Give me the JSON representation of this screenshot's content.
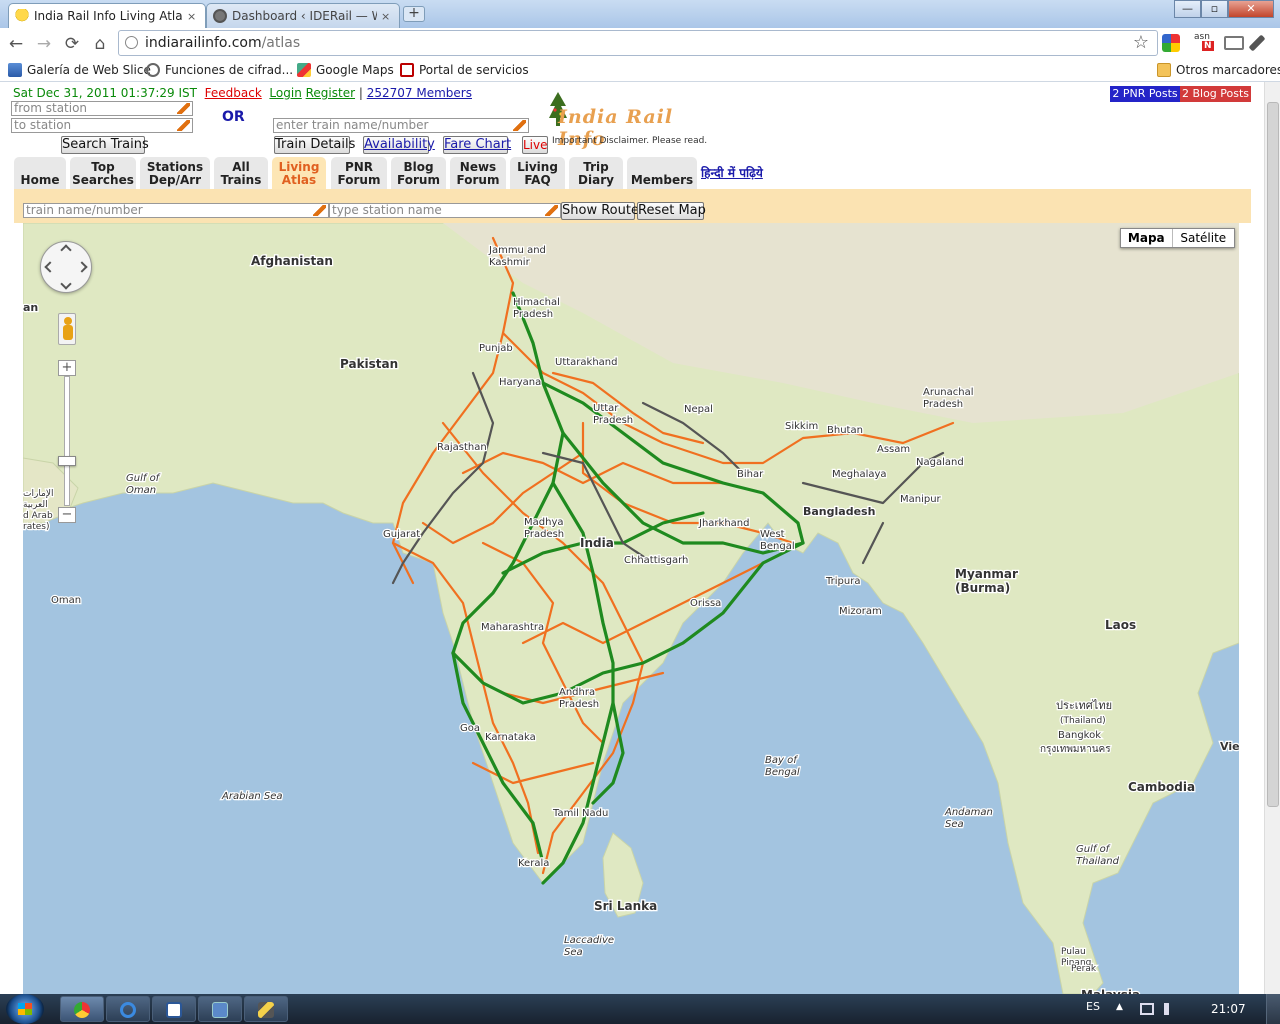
{
  "browser": {
    "tabs": [
      {
        "title": "India Rail Info Living Atlas -",
        "close": "×",
        "active": true
      },
      {
        "title": "Dashboard ‹ IDERail — Wor",
        "close": "×",
        "active": false
      }
    ],
    "new_tab": "+",
    "window_controls": {
      "minimize": "—",
      "maximize": "▫",
      "close": "✕"
    },
    "nav": {
      "back": "←",
      "forward": "→",
      "reload": "⟳",
      "home": "⌂"
    },
    "url_host": "indiarailinfo.com",
    "url_path": "/atlas",
    "star": "☆",
    "bookmarks": [
      {
        "label": "Galería de Web Slice",
        "icon": "web-slice-icon"
      },
      {
        "label": "Funciones de cifrad...",
        "icon": "globe-icon"
      },
      {
        "label": "Google Maps",
        "icon": "maps-pin-icon"
      },
      {
        "label": "Portal de servicios",
        "icon": "portal-icon"
      }
    ],
    "other_bookmarks": "Otros marcadores",
    "extension_badges": {
      "asn": "asn",
      "n": "N"
    }
  },
  "site": {
    "datetime": "Sat Dec 31, 2011 01:37:29 IST",
    "feedback": "Feedback",
    "login": "Login",
    "register": "Register",
    "members_sep": "|",
    "members": "252707 Members",
    "from_placeholder": "from station",
    "to_placeholder": "to station",
    "search_trains": "Search Trains",
    "or": "OR",
    "train_placeholder": "enter train name/number",
    "train_details": "Train Details",
    "availability": "Availability",
    "fare_chart": "Fare Chart",
    "live": "Live",
    "logo_text": "India Rail Info",
    "disclaimer": "Important Disclaimer. Please read.",
    "pnr_posts": "2 PNR Posts",
    "blog_posts": "2 Blog Posts",
    "hindi_link": "हिन्दी में पढ़िये",
    "nav_tabs": [
      "Home",
      "Top\nSearches",
      "Stations\nDep/Arr",
      "All\nTrains",
      "Living\nAtlas",
      "PNR\nForum",
      "Blog\nForum",
      "News\nForum",
      "Living\nFAQ",
      "Trip\nDiary",
      "Members"
    ],
    "selected_tab": "Living\nAtlas",
    "map_bar": {
      "train_placeholder": "train name/number",
      "station_placeholder": "type station name",
      "show_route": "Show Route",
      "reset_map": "Reset Map"
    }
  },
  "map": {
    "type_buttons": [
      "Mapa",
      "Satélite"
    ],
    "zoom_in": "+",
    "zoom_out": "−",
    "labels": [
      "Afghanistan",
      "Pakistan",
      "Nepal",
      "Bhutan",
      "India",
      "Bangladesh",
      "Myanmar\n(Burma)",
      "Laos",
      "Sri Lanka",
      "Cambodia",
      "Malaysia",
      "Jammu and\nKashmir",
      "Himachal\nPradesh",
      "Punjab",
      "Uttarakhand",
      "Haryana",
      "Uttar\nPradesh",
      "Rajasthan",
      "Bihar",
      "Sikkim",
      "Assam",
      "Arunachal\nPradesh",
      "Nagaland",
      "Meghalaya",
      "Manipur",
      "Tripura",
      "Mizoram",
      "Gujarat",
      "Madhya\nPradesh",
      "Jharkhand",
      "West\nBengal",
      "Chhattisgarh",
      "Orissa",
      "Maharashtra",
      "Andhra\nPradesh",
      "Goa",
      "Karnataka",
      "Tamil Nadu",
      "Kerala",
      "Gulf of\nOman",
      "Oman",
      "Arabian Sea",
      "Bay of\nBengal",
      "Andaman\nSea",
      "Gulf of\nThailand",
      "Laccadive\nSea",
      "ประเทศไทย",
      "(Thailand)",
      "Bangkok",
      "กรุงเทพมหานคร",
      "Pulau\nPinang",
      "Perak",
      "Vie",
      "an",
      "الإمارات\nالعربية\nd Arab\nrates)"
    ]
  },
  "taskbar": {
    "lang": "ES",
    "clock": "21:07",
    "tray_arrow": "▲"
  },
  "colors": {
    "mainline": "#1f8a1f",
    "branchline": "#f07020",
    "narrowgauge": "#555555",
    "sea": "#a3c4e0",
    "land": "#dfe8c2",
    "mapbar": "#fbe3b2"
  }
}
